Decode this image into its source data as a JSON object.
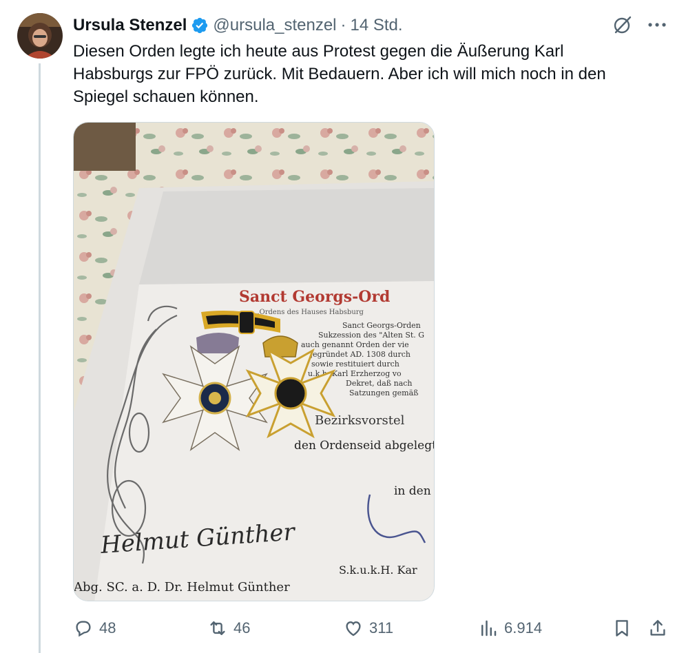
{
  "tweet": {
    "author_name": "Ursula Stenzel",
    "handle": "@ursula_stenzel",
    "separator": "·",
    "time": "14 Std.",
    "text": "Diesen Orden legte ich heute aus Protest gegen die Äußerung Karl\nHabsburgs zur FPÖ zurück. Mit Bedauern. Aber ich will mich noch in den\nSpiegel schauen können."
  },
  "media": {
    "certificate_title": "Sanct Georgs-Ord",
    "certificate_subtitle": "...Ordens des Hauses Habsburg",
    "lines": [
      "Sanct Georgs-Orden",
      "Sukzession des \"Alten St. G",
      "auch genannt Orden der vie",
      "gegründet AD. 1308 durch",
      "sowie restituiert durch",
      "u.k.h. Karl Erzherzog vo",
      "Dekret, daß nach",
      "Satzungen gemäß"
    ],
    "recipient_line": "Bezirksvorstel",
    "oath_line": "den Ordenseid abgelegt",
    "place_line": "in den",
    "signature": "Helmut Günther",
    "signature_caption": "Abg. SC. a. D. Dr. Helmut Günther",
    "signature_caption_right": "S.k.u.k.H. Kar"
  },
  "stats": {
    "replies": "48",
    "reposts": "46",
    "likes": "311",
    "views": "6.914"
  },
  "colors": {
    "verified": "#1d9bf0",
    "secondary_text": "#536471",
    "thread_line": "#cfd9de"
  },
  "icons": [
    "verified-badge-icon",
    "grok-icon",
    "more-icon",
    "reply-icon",
    "repost-icon",
    "like-icon",
    "views-icon",
    "bookmark-icon",
    "share-icon"
  ]
}
